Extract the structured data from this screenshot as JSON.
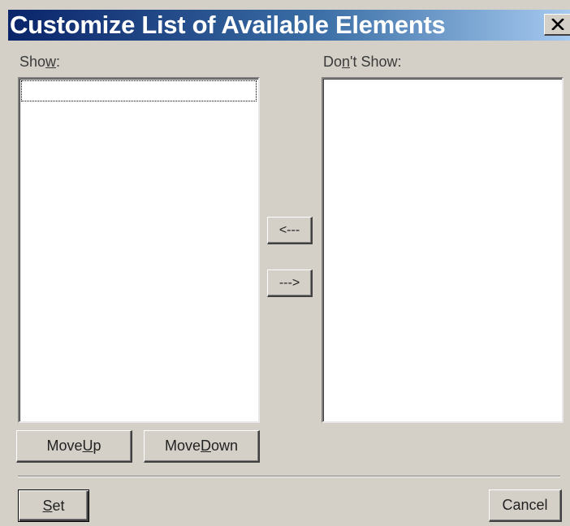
{
  "dialog": {
    "title": "Customize List of Available Elements",
    "close_icon": "close-icon"
  },
  "show_list": {
    "label_before": "Sho",
    "label_mnemonic": "w",
    "label_after": ":",
    "items": []
  },
  "dont_show_list": {
    "label_before": "Do",
    "label_mnemonic": "n",
    "label_after": "'t Show:",
    "items": []
  },
  "move_buttons": {
    "add_label": "<---",
    "remove_label": "--->"
  },
  "order_buttons": {
    "move_up_before": "Move ",
    "move_up_mnemonic": "U",
    "move_up_after": "p",
    "move_down_before": "Move ",
    "move_down_mnemonic": "D",
    "move_down_after": "own"
  },
  "footer": {
    "set_mnemonic": "S",
    "set_after": "et",
    "cancel_label": "Cancel"
  }
}
